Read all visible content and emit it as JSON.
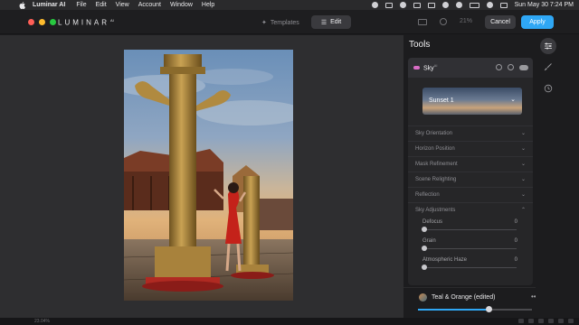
{
  "menubar": {
    "app_name": "Luminar AI",
    "items": [
      "File",
      "Edit",
      "View",
      "Account",
      "Window",
      "Help"
    ],
    "datetime": "Sun May 30  7:24 PM"
  },
  "toolbar": {
    "logo": "LUMINAR",
    "logo_sup": "AI",
    "templates_label": "Templates",
    "edit_label": "Edit",
    "zoom": "21%",
    "cancel_label": "Cancel",
    "apply_label": "Apply",
    "traffic_colors": [
      "#ff5f57",
      "#febc2e",
      "#28c840"
    ]
  },
  "panel": {
    "title": "Tools",
    "tool": {
      "name": "Sky",
      "name_sup": "AI",
      "sky_preset": "Sunset 1",
      "sections": [
        "Sky Orientation",
        "Horizon Position",
        "Mask Refinement",
        "Scene Relighting",
        "Reflection",
        "Sky Adjustments"
      ],
      "sliders": [
        {
          "label": "Defocus",
          "value": "0"
        },
        {
          "label": "Grain",
          "value": "0"
        },
        {
          "label": "Atmospheric Haze",
          "value": "0"
        }
      ]
    }
  },
  "preset": {
    "name": "Teal & Orange (edited)",
    "more": "•••",
    "amount": 0.62
  },
  "statusbar": {
    "zoom": "23.04%"
  },
  "colors": {
    "accent": "#2fa7f5",
    "sky_icon": "#d86cc5"
  },
  "icons": {
    "rail": [
      "sliders-icon",
      "brush-icon",
      "history-icon"
    ]
  }
}
